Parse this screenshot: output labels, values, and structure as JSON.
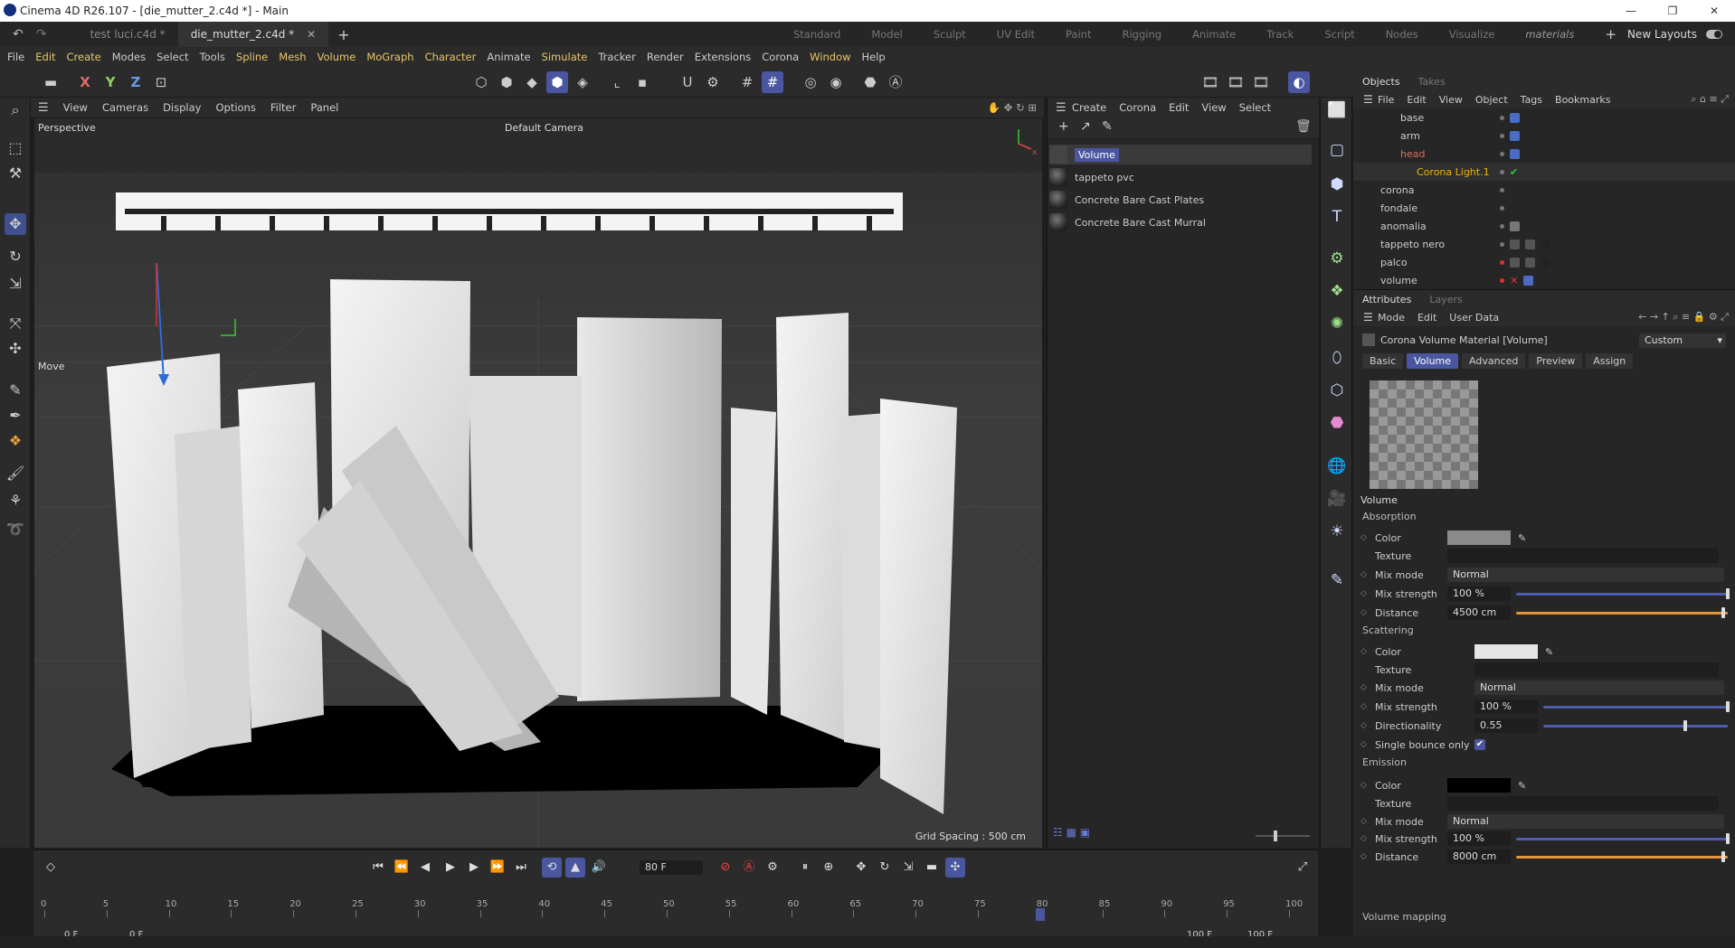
{
  "window": {
    "title": "Cinema 4D R26.107 - [die_mutter_2.c4d *] - Main",
    "controls": [
      "—",
      "❐",
      "✕"
    ]
  },
  "doc_tabs": [
    {
      "label": "test luci.c4d *",
      "active": false
    },
    {
      "label": "die_mutter_2.c4d *",
      "active": true
    }
  ],
  "layouts": [
    "Standard",
    "Model",
    "Sculpt",
    "UV Edit",
    "Paint",
    "Rigging",
    "Animate",
    "Track",
    "Script",
    "Nodes",
    "Visualize",
    "materials"
  ],
  "new_layouts": "New Layouts",
  "menu": [
    "File",
    "Edit",
    "Create",
    "Modes",
    "Select",
    "Tools",
    "Spline",
    "Mesh",
    "Volume",
    "MoGraph",
    "Character",
    "Animate",
    "Simulate",
    "Tracker",
    "Render",
    "Extensions",
    "Corona",
    "Window",
    "Help"
  ],
  "axes": {
    "x": "X",
    "y": "Y",
    "z": "Z"
  },
  "viewport": {
    "menu": [
      "View",
      "Cameras",
      "Display",
      "Options",
      "Filter",
      "Panel"
    ],
    "name": "Perspective",
    "camera": "Default Camera",
    "tool_label": "Move",
    "grid_spacing": "Grid Spacing : 500 cm"
  },
  "material_manager": {
    "menu": [
      "Create",
      "Corona",
      "Edit",
      "View",
      "Select"
    ],
    "materials": [
      {
        "name": "Volume",
        "selected": true
      },
      {
        "name": "tappeto pvc",
        "selected": false
      },
      {
        "name": "Concrete Bare Cast Plates",
        "selected": false
      },
      {
        "name": "Concrete Bare Cast Murral",
        "selected": false
      }
    ]
  },
  "objects_panel": {
    "tabs": [
      "Objects",
      "Takes"
    ],
    "menu": [
      "File",
      "Edit",
      "View",
      "Object",
      "Tags",
      "Bookmarks"
    ],
    "rows": [
      {
        "name": "base",
        "indent": 2,
        "color": "#cccccc"
      },
      {
        "name": "arm",
        "indent": 2,
        "color": "#cccccc"
      },
      {
        "name": "head",
        "indent": 2,
        "color": "#e26b5b"
      },
      {
        "name": "Corona Light.1",
        "indent": 3,
        "color": "#f0b400"
      },
      {
        "name": "corona",
        "indent": 0,
        "color": "#cccccc"
      },
      {
        "name": "fondale",
        "indent": 0,
        "color": "#cccccc"
      },
      {
        "name": "anomalia",
        "indent": 0,
        "color": "#cccccc"
      },
      {
        "name": "tappeto nero",
        "indent": 0,
        "color": "#cccccc"
      },
      {
        "name": "palco",
        "indent": 0,
        "color": "#cccccc"
      },
      {
        "name": "volume",
        "indent": 0,
        "color": "#cccccc"
      }
    ]
  },
  "attributes": {
    "tabs": [
      "Attributes",
      "Layers"
    ],
    "menu": [
      "Mode",
      "Edit",
      "User Data"
    ],
    "object_title": "Corona Volume Material [Volume]",
    "preset": "Custom",
    "subtabs": [
      "Basic",
      "Volume",
      "Advanced",
      "Preview",
      "Assign"
    ],
    "active_subtab": "Volume",
    "section": "Volume",
    "absorption": {
      "title": "Absorption",
      "color_label": "Color",
      "color": "#8a8a8a",
      "texture_label": "Texture",
      "mix_mode_label": "Mix mode",
      "mix_mode": "Normal",
      "mix_strength_label": "Mix strength",
      "mix_strength": "100 %",
      "mix_strength_frac": 1.0,
      "distance_label": "Distance",
      "distance": "4500 cm",
      "distance_frac": 0.98
    },
    "scattering": {
      "title": "Scattering",
      "color_label": "Color",
      "color": "#e6e6e6",
      "texture_label": "Texture",
      "mix_mode_label": "Mix mode",
      "mix_mode": "Normal",
      "mix_strength_label": "Mix strength",
      "mix_strength": "100 %",
      "mix_strength_frac": 1.0,
      "directionality_label": "Directionality",
      "directionality": "0.55",
      "directionality_frac": 0.77,
      "single_bounce_label": "Single bounce only",
      "single_bounce": true
    },
    "emission": {
      "title": "Emission",
      "color_label": "Color",
      "color": "#000000",
      "texture_label": "Texture",
      "mix_mode_label": "Mix mode",
      "mix_mode": "Normal",
      "mix_strength_label": "Mix strength",
      "mix_strength": "100 %",
      "mix_strength_frac": 1.0,
      "distance_label": "Distance",
      "distance": "8000 cm",
      "distance_frac": 0.98
    },
    "volume_mapping": "Volume mapping"
  },
  "timeline": {
    "current_frame": "80 F",
    "start": "0 F",
    "start2": "0 F",
    "end": "100 F",
    "end2": "100 F",
    "ticks": [
      "0",
      "5",
      "10",
      "15",
      "20",
      "25",
      "30",
      "35",
      "40",
      "45",
      "50",
      "55",
      "60",
      "65",
      "70",
      "75",
      "80",
      "85",
      "90",
      "95",
      "100"
    ],
    "playhead_frac": 0.8
  },
  "colors": {
    "accent": "#4a57a0",
    "selection": "#4f5db0",
    "warning": "#e26b5b"
  }
}
